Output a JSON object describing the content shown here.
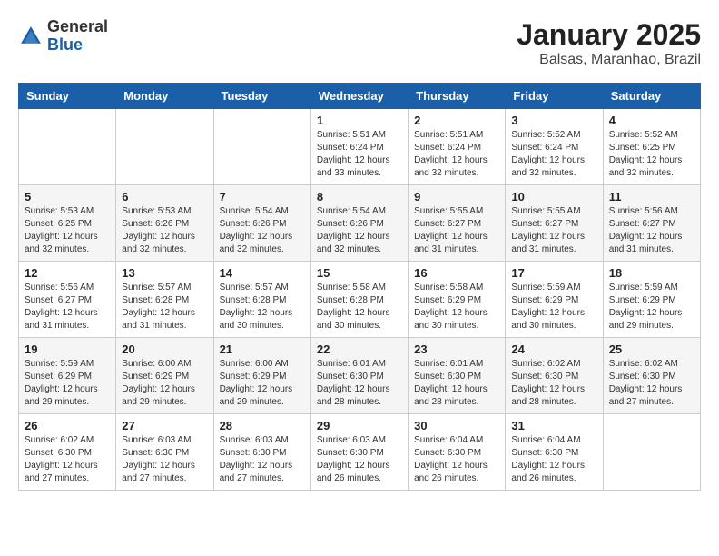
{
  "header": {
    "logo_general": "General",
    "logo_blue": "Blue",
    "title": "January 2025",
    "subtitle": "Balsas, Maranhao, Brazil"
  },
  "weekdays": [
    "Sunday",
    "Monday",
    "Tuesday",
    "Wednesday",
    "Thursday",
    "Friday",
    "Saturday"
  ],
  "weeks": [
    [
      {
        "day": "",
        "detail": ""
      },
      {
        "day": "",
        "detail": ""
      },
      {
        "day": "",
        "detail": ""
      },
      {
        "day": "1",
        "detail": "Sunrise: 5:51 AM\nSunset: 6:24 PM\nDaylight: 12 hours and 33 minutes."
      },
      {
        "day": "2",
        "detail": "Sunrise: 5:51 AM\nSunset: 6:24 PM\nDaylight: 12 hours and 32 minutes."
      },
      {
        "day": "3",
        "detail": "Sunrise: 5:52 AM\nSunset: 6:24 PM\nDaylight: 12 hours and 32 minutes."
      },
      {
        "day": "4",
        "detail": "Sunrise: 5:52 AM\nSunset: 6:25 PM\nDaylight: 12 hours and 32 minutes."
      }
    ],
    [
      {
        "day": "5",
        "detail": "Sunrise: 5:53 AM\nSunset: 6:25 PM\nDaylight: 12 hours and 32 minutes."
      },
      {
        "day": "6",
        "detail": "Sunrise: 5:53 AM\nSunset: 6:26 PM\nDaylight: 12 hours and 32 minutes."
      },
      {
        "day": "7",
        "detail": "Sunrise: 5:54 AM\nSunset: 6:26 PM\nDaylight: 12 hours and 32 minutes."
      },
      {
        "day": "8",
        "detail": "Sunrise: 5:54 AM\nSunset: 6:26 PM\nDaylight: 12 hours and 32 minutes."
      },
      {
        "day": "9",
        "detail": "Sunrise: 5:55 AM\nSunset: 6:27 PM\nDaylight: 12 hours and 31 minutes."
      },
      {
        "day": "10",
        "detail": "Sunrise: 5:55 AM\nSunset: 6:27 PM\nDaylight: 12 hours and 31 minutes."
      },
      {
        "day": "11",
        "detail": "Sunrise: 5:56 AM\nSunset: 6:27 PM\nDaylight: 12 hours and 31 minutes."
      }
    ],
    [
      {
        "day": "12",
        "detail": "Sunrise: 5:56 AM\nSunset: 6:27 PM\nDaylight: 12 hours and 31 minutes."
      },
      {
        "day": "13",
        "detail": "Sunrise: 5:57 AM\nSunset: 6:28 PM\nDaylight: 12 hours and 31 minutes."
      },
      {
        "day": "14",
        "detail": "Sunrise: 5:57 AM\nSunset: 6:28 PM\nDaylight: 12 hours and 30 minutes."
      },
      {
        "day": "15",
        "detail": "Sunrise: 5:58 AM\nSunset: 6:28 PM\nDaylight: 12 hours and 30 minutes."
      },
      {
        "day": "16",
        "detail": "Sunrise: 5:58 AM\nSunset: 6:29 PM\nDaylight: 12 hours and 30 minutes."
      },
      {
        "day": "17",
        "detail": "Sunrise: 5:59 AM\nSunset: 6:29 PM\nDaylight: 12 hours and 30 minutes."
      },
      {
        "day": "18",
        "detail": "Sunrise: 5:59 AM\nSunset: 6:29 PM\nDaylight: 12 hours and 29 minutes."
      }
    ],
    [
      {
        "day": "19",
        "detail": "Sunrise: 5:59 AM\nSunset: 6:29 PM\nDaylight: 12 hours and 29 minutes."
      },
      {
        "day": "20",
        "detail": "Sunrise: 6:00 AM\nSunset: 6:29 PM\nDaylight: 12 hours and 29 minutes."
      },
      {
        "day": "21",
        "detail": "Sunrise: 6:00 AM\nSunset: 6:29 PM\nDaylight: 12 hours and 29 minutes."
      },
      {
        "day": "22",
        "detail": "Sunrise: 6:01 AM\nSunset: 6:30 PM\nDaylight: 12 hours and 28 minutes."
      },
      {
        "day": "23",
        "detail": "Sunrise: 6:01 AM\nSunset: 6:30 PM\nDaylight: 12 hours and 28 minutes."
      },
      {
        "day": "24",
        "detail": "Sunrise: 6:02 AM\nSunset: 6:30 PM\nDaylight: 12 hours and 28 minutes."
      },
      {
        "day": "25",
        "detail": "Sunrise: 6:02 AM\nSunset: 6:30 PM\nDaylight: 12 hours and 27 minutes."
      }
    ],
    [
      {
        "day": "26",
        "detail": "Sunrise: 6:02 AM\nSunset: 6:30 PM\nDaylight: 12 hours and 27 minutes."
      },
      {
        "day": "27",
        "detail": "Sunrise: 6:03 AM\nSunset: 6:30 PM\nDaylight: 12 hours and 27 minutes."
      },
      {
        "day": "28",
        "detail": "Sunrise: 6:03 AM\nSunset: 6:30 PM\nDaylight: 12 hours and 27 minutes."
      },
      {
        "day": "29",
        "detail": "Sunrise: 6:03 AM\nSunset: 6:30 PM\nDaylight: 12 hours and 26 minutes."
      },
      {
        "day": "30",
        "detail": "Sunrise: 6:04 AM\nSunset: 6:30 PM\nDaylight: 12 hours and 26 minutes."
      },
      {
        "day": "31",
        "detail": "Sunrise: 6:04 AM\nSunset: 6:30 PM\nDaylight: 12 hours and 26 minutes."
      },
      {
        "day": "",
        "detail": ""
      }
    ]
  ]
}
